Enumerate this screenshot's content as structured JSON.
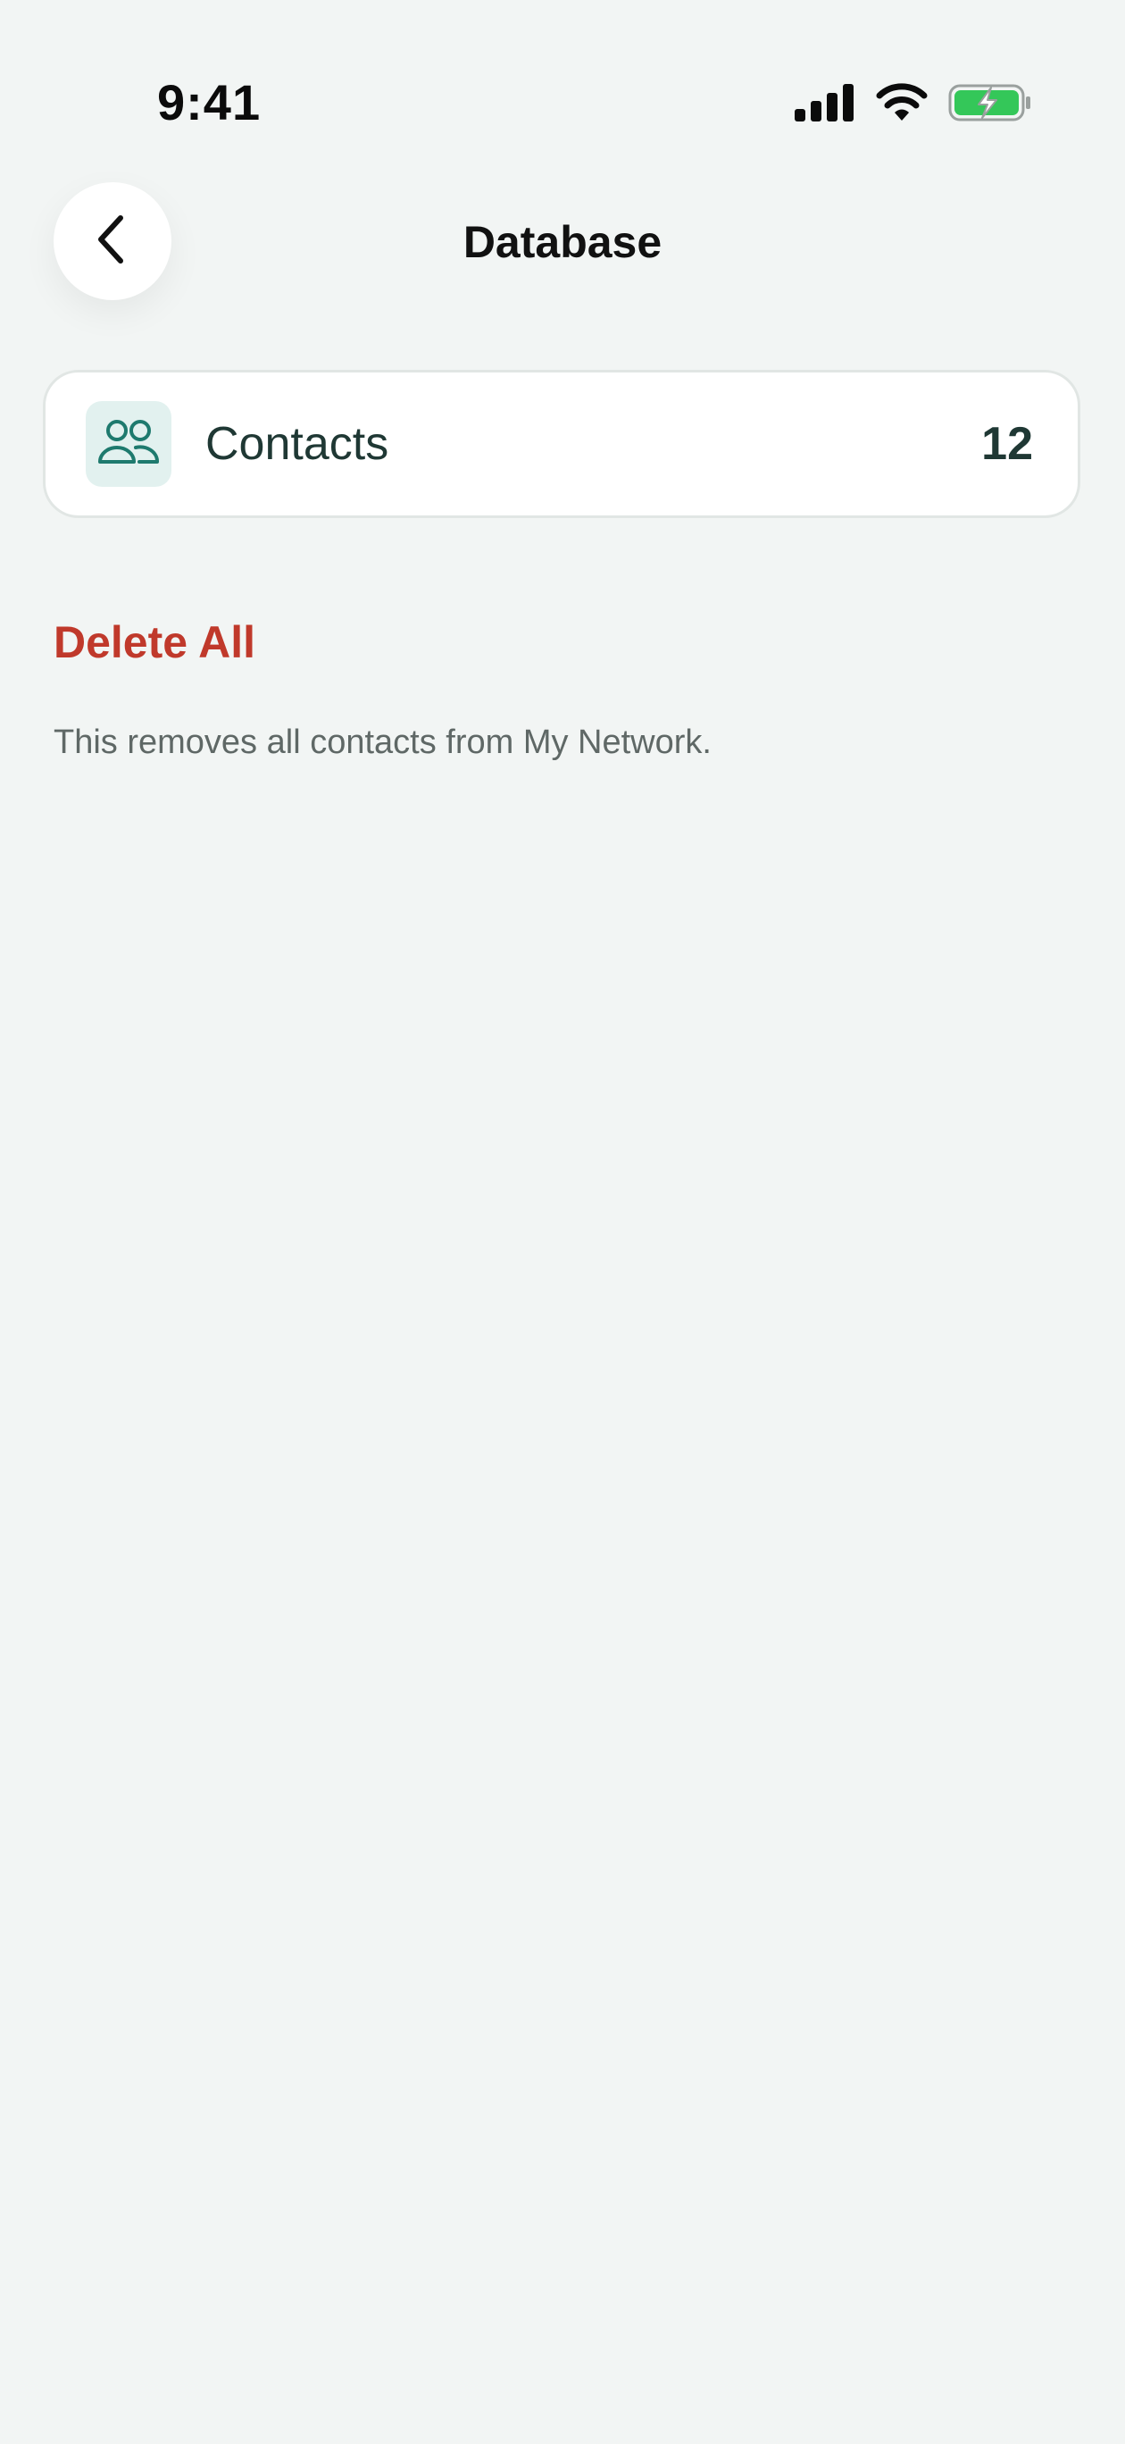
{
  "status_bar": {
    "time": "9:41",
    "icons": [
      "cellular-signal-icon",
      "wifi-icon",
      "battery-charging-icon"
    ]
  },
  "header": {
    "title": "Database",
    "back_icon": "chevron-left-icon"
  },
  "contacts_card": {
    "icon": "people-icon",
    "label": "Contacts",
    "count": "12"
  },
  "delete_section": {
    "button_label": "Delete All",
    "description": "This removes all contacts from My Network."
  },
  "colors": {
    "background": "#f2f5f4",
    "accent_teal": "#1e7a6e",
    "icon_bg": "#e2f1ef",
    "danger": "#c0392b",
    "battery_green": "#34c759"
  }
}
